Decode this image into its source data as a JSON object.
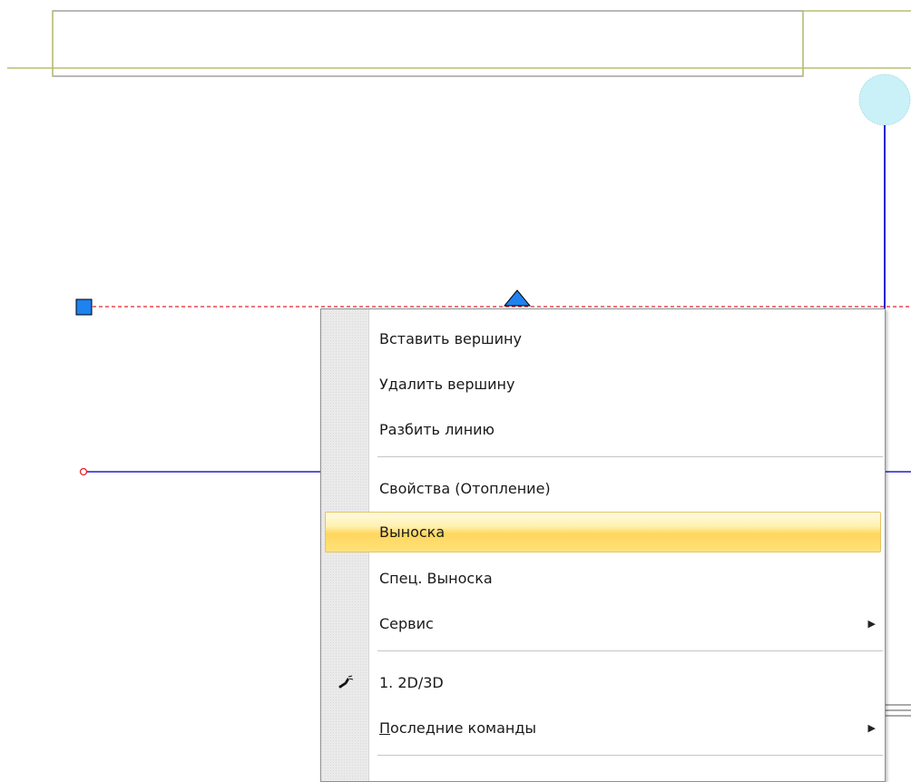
{
  "context_menu": {
    "items": [
      {
        "label": "Вставить вершину",
        "separator_after": false
      },
      {
        "label": "Удалить вершину",
        "separator_after": false
      },
      {
        "label": "Разбить линию",
        "separator_after": true
      },
      {
        "label": "Свойства (Отопление)",
        "separator_after": false
      },
      {
        "label": "Выноска",
        "highlighted": true,
        "separator_after": false
      },
      {
        "label": "Спец. Выноска",
        "separator_after": false
      },
      {
        "label": "Сервис",
        "submenu": true,
        "separator_after": true
      },
      {
        "label": "1. 2D/3D",
        "icon": "pipe-tool-icon",
        "separator_after": false
      },
      {
        "label": "Последние команды",
        "submenu": true,
        "accelerator_underlined": "П",
        "separator_after": true
      }
    ],
    "submenu_arrow": "▶"
  },
  "colors": {
    "highlight": "#ffd65e",
    "pipe_line": "#1f1fd1",
    "dashed_line": "#e0242d",
    "grip": "#1e82f0",
    "room_wall": "#b9bd6e",
    "circle": "#c9f1f7"
  }
}
